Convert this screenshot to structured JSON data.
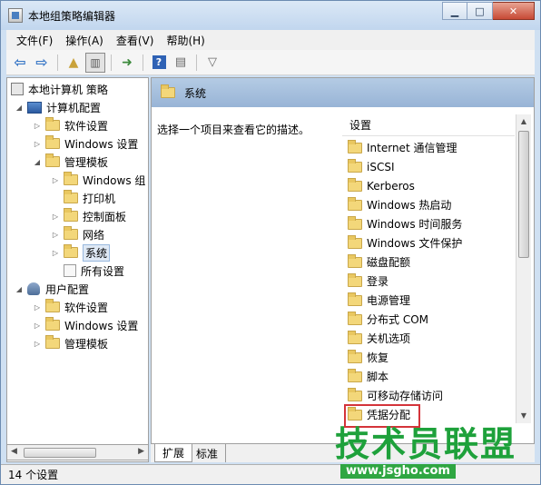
{
  "window": {
    "title": "本地组策略编辑器",
    "controls": {
      "minimize": "▁",
      "maximize": "□",
      "close": "✕"
    }
  },
  "menu": [
    "文件(F)",
    "操作(A)",
    "查看(V)",
    "帮助(H)"
  ],
  "toolbar": {
    "icons": [
      "back-arrow-icon",
      "forward-arrow-icon",
      "up-folder-icon",
      "show-tree-icon",
      "export-list-icon",
      "help-icon",
      "properties-icon",
      "filter-icon"
    ]
  },
  "tree": {
    "root": "本地计算机 策略",
    "computer_config": "计算机配置",
    "software_settings": "软件设置",
    "windows_settings": "Windows 设置",
    "admin_templates": "管理模板",
    "windows_components": "Windows 组",
    "printers": "打印机",
    "control_panel": "控制面板",
    "network": "网络",
    "system": "系统",
    "all_settings": "所有设置",
    "user_config": "用户配置",
    "user_software_settings": "软件设置",
    "user_windows_settings": "Windows 设置",
    "user_admin_templates": "管理模板"
  },
  "details": {
    "header_title": "系统",
    "description": "选择一个项目来查看它的描述。",
    "column_header": "设置",
    "items": [
      "Internet 通信管理",
      "iSCSI",
      "Kerberos",
      "Windows 热启动",
      "Windows 时间服务",
      "Windows 文件保护",
      "磁盘配额",
      "登录",
      "电源管理",
      "分布式 COM",
      "关机选项",
      "恢复",
      "脚本",
      "可移动存储访问",
      "凭据分配"
    ]
  },
  "tabs": {
    "extended": "扩展",
    "standard": "标准"
  },
  "status": {
    "text": "14 个设置"
  },
  "watermark": {
    "title": "技术员联盟",
    "url": "www.jsgho.com"
  },
  "colors": {
    "highlight_box": "#d4343a",
    "watermark_green": "#1ea13b"
  }
}
